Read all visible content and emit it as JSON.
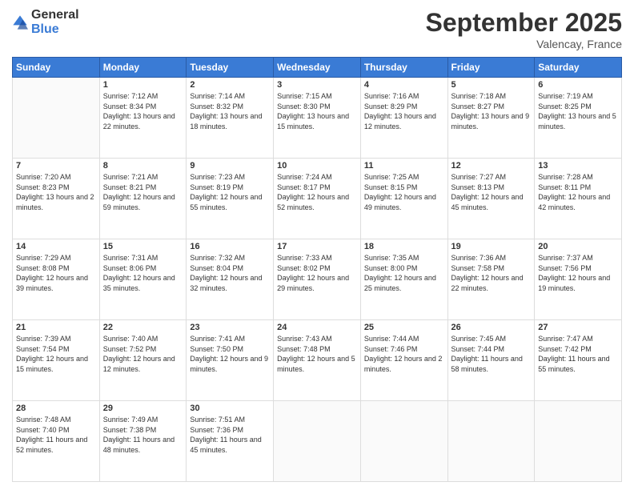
{
  "logo": {
    "general": "General",
    "blue": "Blue"
  },
  "title": "September 2025",
  "location": "Valencay, France",
  "weekdays": [
    "Sunday",
    "Monday",
    "Tuesday",
    "Wednesday",
    "Thursday",
    "Friday",
    "Saturday"
  ],
  "weeks": [
    [
      {
        "day": "",
        "info": ""
      },
      {
        "day": "1",
        "info": "Sunrise: 7:12 AM\nSunset: 8:34 PM\nDaylight: 13 hours and 22 minutes."
      },
      {
        "day": "2",
        "info": "Sunrise: 7:14 AM\nSunset: 8:32 PM\nDaylight: 13 hours and 18 minutes."
      },
      {
        "day": "3",
        "info": "Sunrise: 7:15 AM\nSunset: 8:30 PM\nDaylight: 13 hours and 15 minutes."
      },
      {
        "day": "4",
        "info": "Sunrise: 7:16 AM\nSunset: 8:29 PM\nDaylight: 13 hours and 12 minutes."
      },
      {
        "day": "5",
        "info": "Sunrise: 7:18 AM\nSunset: 8:27 PM\nDaylight: 13 hours and 9 minutes."
      },
      {
        "day": "6",
        "info": "Sunrise: 7:19 AM\nSunset: 8:25 PM\nDaylight: 13 hours and 5 minutes."
      }
    ],
    [
      {
        "day": "7",
        "info": "Sunrise: 7:20 AM\nSunset: 8:23 PM\nDaylight: 13 hours and 2 minutes."
      },
      {
        "day": "8",
        "info": "Sunrise: 7:21 AM\nSunset: 8:21 PM\nDaylight: 12 hours and 59 minutes."
      },
      {
        "day": "9",
        "info": "Sunrise: 7:23 AM\nSunset: 8:19 PM\nDaylight: 12 hours and 55 minutes."
      },
      {
        "day": "10",
        "info": "Sunrise: 7:24 AM\nSunset: 8:17 PM\nDaylight: 12 hours and 52 minutes."
      },
      {
        "day": "11",
        "info": "Sunrise: 7:25 AM\nSunset: 8:15 PM\nDaylight: 12 hours and 49 minutes."
      },
      {
        "day": "12",
        "info": "Sunrise: 7:27 AM\nSunset: 8:13 PM\nDaylight: 12 hours and 45 minutes."
      },
      {
        "day": "13",
        "info": "Sunrise: 7:28 AM\nSunset: 8:11 PM\nDaylight: 12 hours and 42 minutes."
      }
    ],
    [
      {
        "day": "14",
        "info": "Sunrise: 7:29 AM\nSunset: 8:08 PM\nDaylight: 12 hours and 39 minutes."
      },
      {
        "day": "15",
        "info": "Sunrise: 7:31 AM\nSunset: 8:06 PM\nDaylight: 12 hours and 35 minutes."
      },
      {
        "day": "16",
        "info": "Sunrise: 7:32 AM\nSunset: 8:04 PM\nDaylight: 12 hours and 32 minutes."
      },
      {
        "day": "17",
        "info": "Sunrise: 7:33 AM\nSunset: 8:02 PM\nDaylight: 12 hours and 29 minutes."
      },
      {
        "day": "18",
        "info": "Sunrise: 7:35 AM\nSunset: 8:00 PM\nDaylight: 12 hours and 25 minutes."
      },
      {
        "day": "19",
        "info": "Sunrise: 7:36 AM\nSunset: 7:58 PM\nDaylight: 12 hours and 22 minutes."
      },
      {
        "day": "20",
        "info": "Sunrise: 7:37 AM\nSunset: 7:56 PM\nDaylight: 12 hours and 19 minutes."
      }
    ],
    [
      {
        "day": "21",
        "info": "Sunrise: 7:39 AM\nSunset: 7:54 PM\nDaylight: 12 hours and 15 minutes."
      },
      {
        "day": "22",
        "info": "Sunrise: 7:40 AM\nSunset: 7:52 PM\nDaylight: 12 hours and 12 minutes."
      },
      {
        "day": "23",
        "info": "Sunrise: 7:41 AM\nSunset: 7:50 PM\nDaylight: 12 hours and 9 minutes."
      },
      {
        "day": "24",
        "info": "Sunrise: 7:43 AM\nSunset: 7:48 PM\nDaylight: 12 hours and 5 minutes."
      },
      {
        "day": "25",
        "info": "Sunrise: 7:44 AM\nSunset: 7:46 PM\nDaylight: 12 hours and 2 minutes."
      },
      {
        "day": "26",
        "info": "Sunrise: 7:45 AM\nSunset: 7:44 PM\nDaylight: 11 hours and 58 minutes."
      },
      {
        "day": "27",
        "info": "Sunrise: 7:47 AM\nSunset: 7:42 PM\nDaylight: 11 hours and 55 minutes."
      }
    ],
    [
      {
        "day": "28",
        "info": "Sunrise: 7:48 AM\nSunset: 7:40 PM\nDaylight: 11 hours and 52 minutes."
      },
      {
        "day": "29",
        "info": "Sunrise: 7:49 AM\nSunset: 7:38 PM\nDaylight: 11 hours and 48 minutes."
      },
      {
        "day": "30",
        "info": "Sunrise: 7:51 AM\nSunset: 7:36 PM\nDaylight: 11 hours and 45 minutes."
      },
      {
        "day": "",
        "info": ""
      },
      {
        "day": "",
        "info": ""
      },
      {
        "day": "",
        "info": ""
      },
      {
        "day": "",
        "info": ""
      }
    ]
  ]
}
